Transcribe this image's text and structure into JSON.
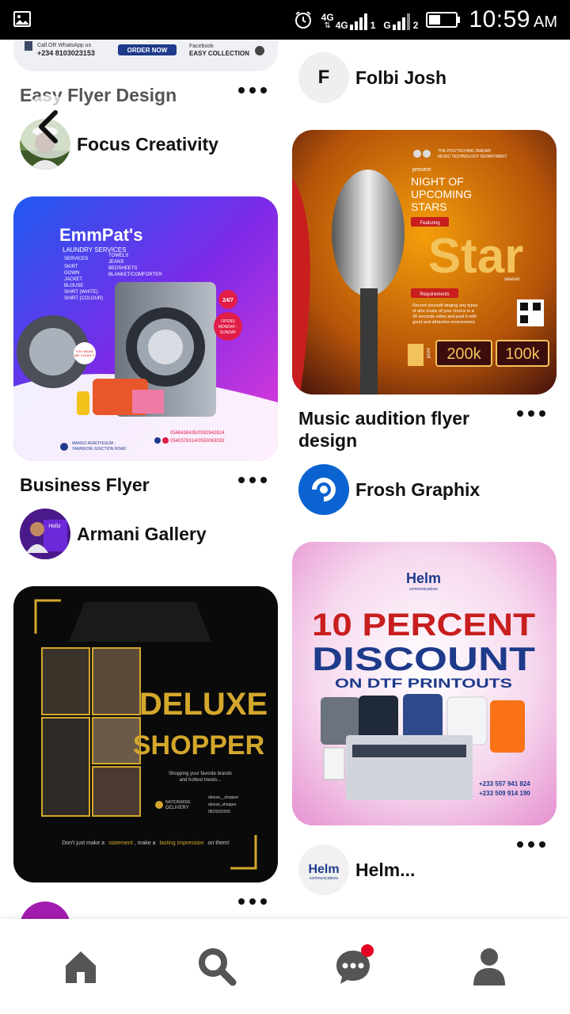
{
  "status_bar": {
    "network_1": "4G",
    "network_2": "4G",
    "sim_1": "1",
    "sim_2": "2",
    "network_label_g": "G",
    "time": "10:59",
    "ampm": "AM"
  },
  "colors": {
    "accent": "#e60023",
    "nav_icon": "#555555",
    "text": "#111111"
  },
  "feed": {
    "left": [
      {
        "title": "Easy Flyer Design",
        "creator": "Focus Creativity",
        "image_text": {
          "phone_label": "Call OR WhatsApp us",
          "phone": "+234 8103023153",
          "order": "ORDER NOW",
          "facebook": "Facebook",
          "collection": "EASY COLLECTION"
        }
      },
      {
        "title": "Business Flyer",
        "creator": "Armani Gallery",
        "image_text": {
          "brand": "EmmPat's",
          "subtitle": "LAUNDRY SERVICES",
          "services_heading": "SERVICES",
          "services_col1": [
            "SKIRT",
            "GOWN",
            "JACKET",
            "BLOUSE",
            "SHIRT (WHITE)",
            "SHIRT (COLOUR)"
          ],
          "services_col2": [
            "TOWELS",
            "JEANS",
            "BEDSHEETS",
            "BLANKET/COMFORTER"
          ],
          "badge_247": "24/7",
          "open_line1": "OPENS",
          "open_line2": "MONDAY -",
          "open_line3": "SUNDAY",
          "sticker_line1": "YOU WEAR,",
          "sticker_line2": "WE CLEAN IT",
          "address_line1": "MANSO AGROYESUM -",
          "address_line2": "YAWKROM JUNCTION ROAD",
          "phone_line1": "0546436435/0592942824",
          "phone_line2": "0540378314/0550063033",
          "avatar_label": "Holiz"
        }
      },
      {
        "title": "",
        "creator": "",
        "image_text": {
          "title_line1": "DELUXE",
          "title_line2": "SHOPPER",
          "tagline_line1": "Shopping your favorite brands",
          "tagline_line2": "and hottest trends...",
          "delivery_line1": "NATIONWIDE",
          "delivery_line2": "DELIVERY",
          "handle1": "deluxe__shopper",
          "handle2": "deluxe_shopper",
          "phone": "0815933269",
          "footer_start": "Don't just make a",
          "footer_mid1": "statement",
          "footer_mid2": ", make a",
          "footer_mid3": "lasting impression",
          "footer_end": "on them!"
        }
      }
    ],
    "right": [
      {
        "title": "",
        "creator": "Folbi Josh",
        "avatar_letter": "F"
      },
      {
        "title": "Music audition flyer design",
        "creator": "Frosh Graphix",
        "image_text": {
          "dept_line1": "THE POLYTECHNIC IBADAN",
          "dept_line2": "MUSIC TECHNOLOGY DEPARTMENT",
          "present": "present",
          "headline_1": "NIGHT OF",
          "headline_2": "UPCOMING",
          "headline_3": "STARS",
          "featuring": "Featuring",
          "star_word": "Star",
          "season": "season",
          "requirements": "Requirements",
          "req_line1": "Record yourself singing any types",
          "req_line2": "of afro music of your choice in a",
          "req_line3": "30 seconds video and post it with",
          "req_line4": "good and attractive environment.",
          "prize_label": "prize",
          "prize_1": "200k",
          "prize_2": "100k"
        }
      },
      {
        "title": "",
        "creator": "Helm...",
        "image_text": {
          "logo": "Helm",
          "logo_sub": "communications",
          "headline_1": "10 PERCENT",
          "headline_2": "DISCOUNT",
          "headline_3": "ON DTF PRINTOUTS",
          "phone_1": "+233 557 941 824",
          "phone_2": "+233 509 914 190",
          "avatar_logo": "Helm",
          "avatar_sub": "communications"
        }
      }
    ]
  },
  "bottom_nav": {
    "items": [
      "home-icon",
      "search-icon",
      "messages-icon",
      "profile-icon"
    ],
    "messages_has_notification": true
  }
}
